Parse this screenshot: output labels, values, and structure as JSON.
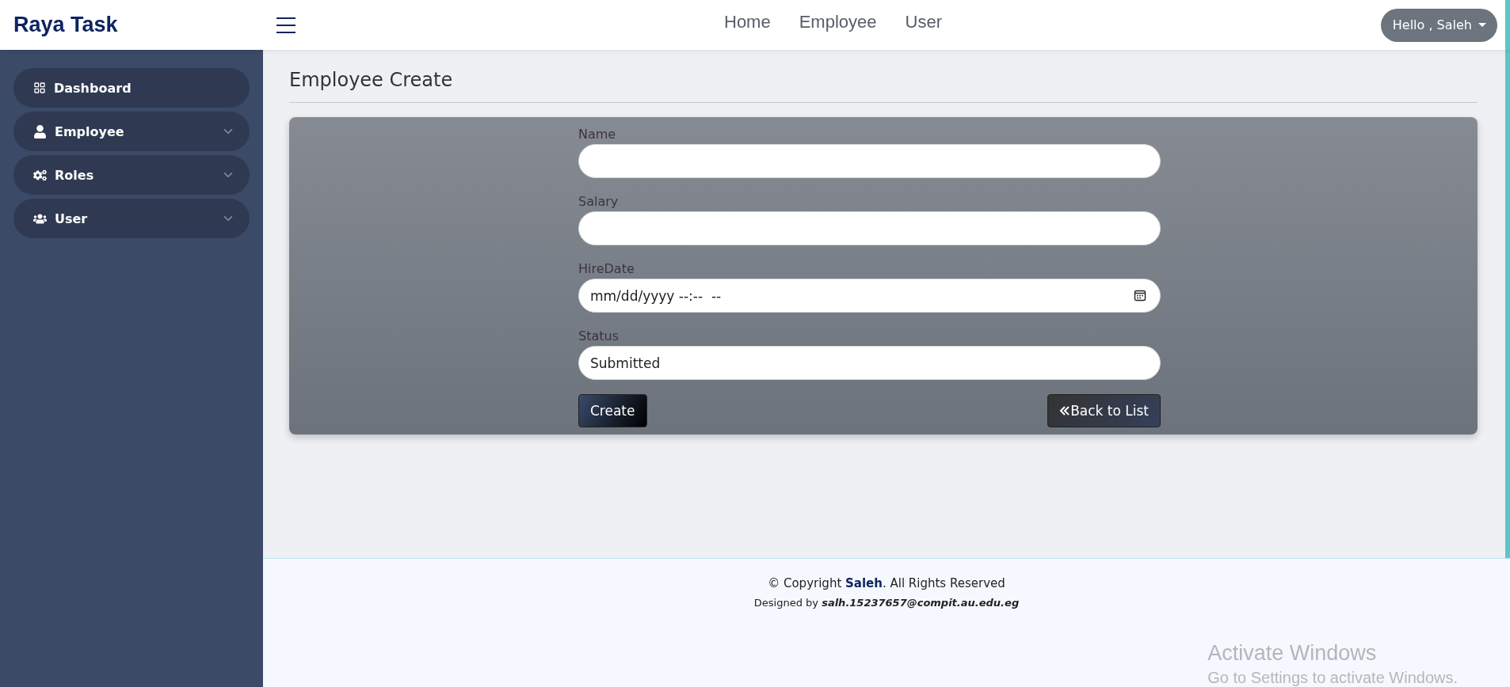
{
  "brand": "Raya Task",
  "nav": [
    {
      "label": "Home"
    },
    {
      "label": "Employee"
    },
    {
      "label": "User"
    }
  ],
  "user_menu": {
    "label": "Hello , Saleh"
  },
  "sidebar": {
    "items": [
      {
        "label": "Dashboard",
        "expandable": false
      },
      {
        "label": "Employee",
        "expandable": true
      },
      {
        "label": "Roles",
        "expandable": true
      },
      {
        "label": "User",
        "expandable": true
      }
    ]
  },
  "page_title": "Employee Create",
  "form": {
    "fields": [
      {
        "label": "Name",
        "kind": "text"
      },
      {
        "label": "Salary",
        "kind": "text"
      },
      {
        "label": "HireDate",
        "kind": "datetime",
        "value": "mm/dd/yyyy --:--  --"
      },
      {
        "label": "Status",
        "kind": "text",
        "value": "Submitted"
      }
    ],
    "submit": "Create",
    "back": "Back to List"
  },
  "footer": {
    "lines": [
      "© Copyright **Saleh**. All Rights Reserved",
      "Designed by **salh.15237657@compit.au.edu.eg**"
    ]
  },
  "os_notice": {
    "title": "Activate Windows",
    "text": "Go to Settings to activate Windows."
  }
}
